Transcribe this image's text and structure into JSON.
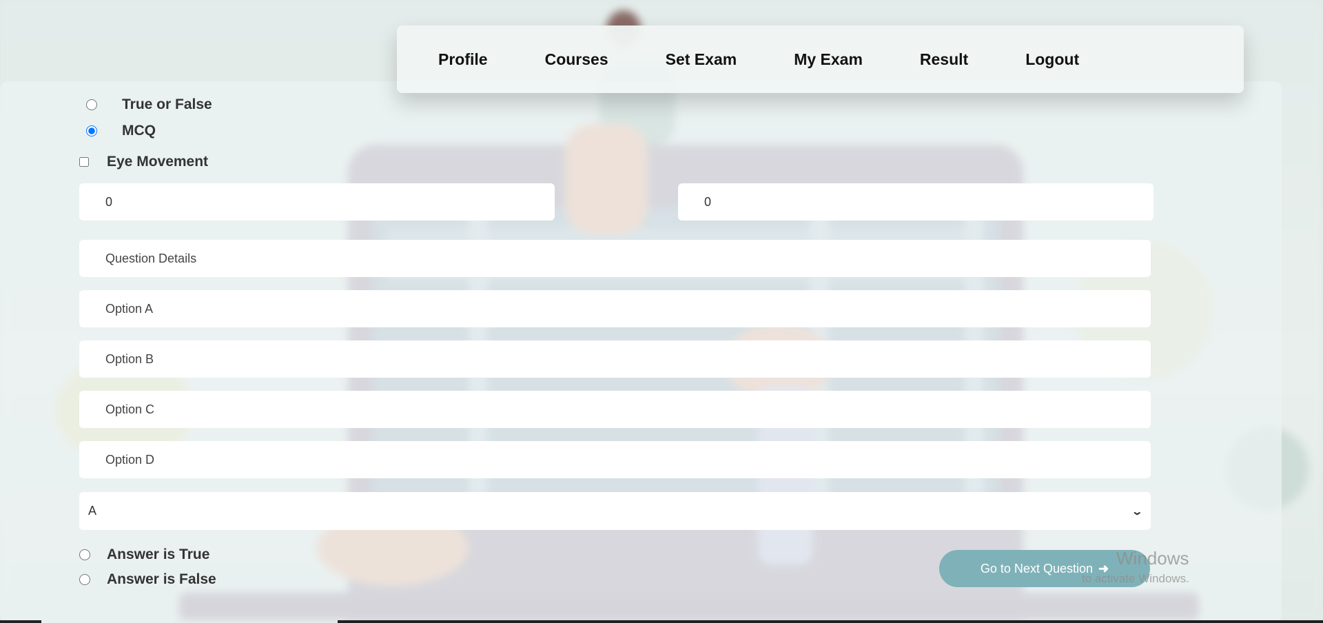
{
  "nav": {
    "items": [
      "Profile",
      "Courses",
      "Set Exam",
      "My Exam",
      "Result",
      "Logout"
    ]
  },
  "question_type": {
    "true_false_label": "True or False",
    "mcq_label": "MCQ",
    "selected": "MCQ"
  },
  "eye_movement": {
    "label": "Eye Movement",
    "checked": false
  },
  "numbers": {
    "left_value": "0",
    "right_value": "0"
  },
  "question": {
    "details_placeholder": "Question Details",
    "option_a_placeholder": "Option A",
    "option_b_placeholder": "Option B",
    "option_c_placeholder": "Option C",
    "option_d_placeholder": "Option D"
  },
  "answer_select": {
    "value": "A"
  },
  "answer_tf": {
    "true_label": "Answer is True",
    "false_label": "Answer is False"
  },
  "next_button": {
    "label": "Go to Next Question",
    "icon": "arrow-right-icon"
  },
  "watermark": {
    "title": "Windows",
    "subtitle": "to activate Windows."
  }
}
